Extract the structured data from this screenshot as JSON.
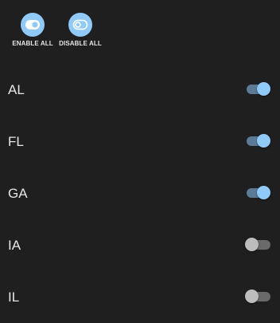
{
  "actions": {
    "enable_label": "ENABLE ALL",
    "disable_label": "DISABLE ALL"
  },
  "states": [
    {
      "label": "AL",
      "enabled": true
    },
    {
      "label": "FL",
      "enabled": true
    },
    {
      "label": "GA",
      "enabled": true
    },
    {
      "label": "IA",
      "enabled": false
    },
    {
      "label": "IL",
      "enabled": false
    }
  ],
  "colors": {
    "background": "#1f1f1f",
    "accent": "#90caf9",
    "track_on": "#5b7b97",
    "track_off": "#6a6a6a",
    "thumb_off": "#bdbdbd"
  }
}
